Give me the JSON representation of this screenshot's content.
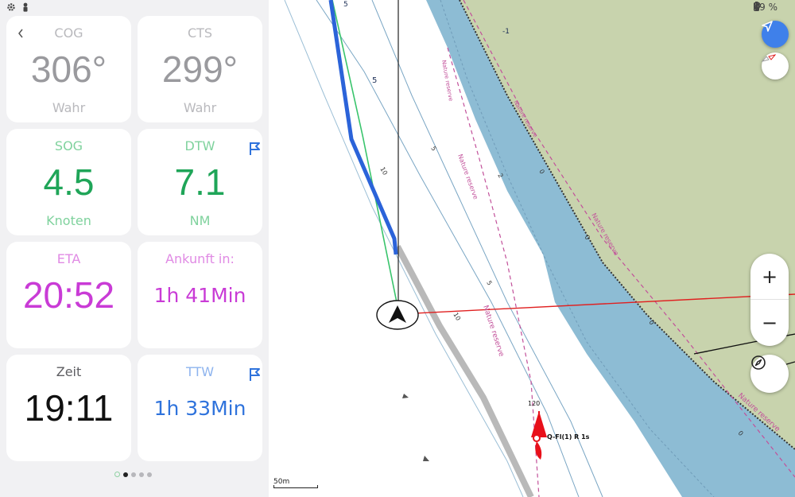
{
  "statusbar": {
    "battery": "49 %",
    "left_icons": [
      "gear-icon",
      "person-icon"
    ],
    "right_icons": [
      "bluetooth-icon",
      "location-pin-icon",
      "battery-icon"
    ]
  },
  "panel": {
    "cards": {
      "cog": {
        "label": "COG",
        "value": "306°",
        "unit": "Wahr"
      },
      "cts": {
        "label": "CTS",
        "value": "299°",
        "unit": "Wahr"
      },
      "sog": {
        "label": "SOG",
        "value": "4.5",
        "unit": "Knoten"
      },
      "dtw": {
        "label": "DTW",
        "value": "7.1",
        "unit": "NM"
      },
      "eta": {
        "label": "ETA",
        "value": "20:52"
      },
      "arrival": {
        "label": "Ankunft in:",
        "value": "1h 41Min"
      },
      "time": {
        "label": "Zeit",
        "value": "19:11"
      },
      "ttw": {
        "label": "TTW",
        "value": "1h 33Min"
      }
    },
    "page_dots": {
      "count": 5,
      "active_index": 1
    }
  },
  "map": {
    "depth_labels": [
      "5",
      "5",
      "-1",
      "5",
      "10",
      "2",
      "0",
      "5",
      "10",
      "0",
      "0",
      "0"
    ],
    "area_labels": [
      "Nature reserve",
      "Nature reserve",
      "Nature reserve",
      "Nature reserve",
      "Nature reserve",
      "Nature reserve"
    ],
    "buoy": {
      "number": "120",
      "light": "Q-Fl(1) R 1s"
    },
    "scale": "50m",
    "zoom_in": "+",
    "zoom_out": "−"
  },
  "colors": {
    "water_deep": "#8dbcd4",
    "land": "#c8d3ad",
    "track": "#2b63d9",
    "route": "#39c46c",
    "bearing_line": "#e02020",
    "buoy": "#e8101a",
    "nature_reserve": "#c2509a"
  }
}
